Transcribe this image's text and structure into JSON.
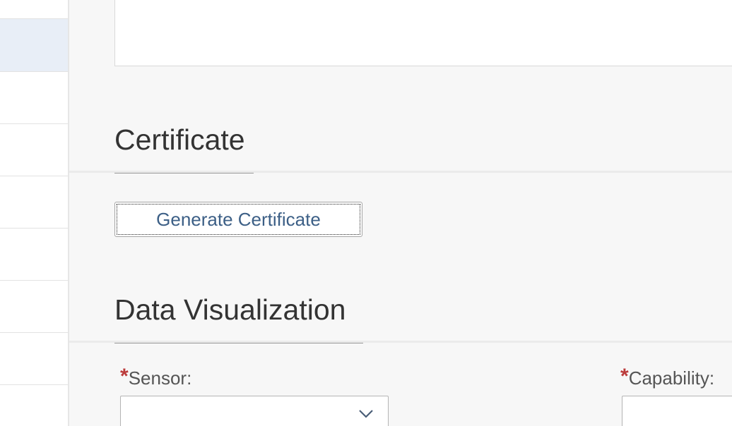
{
  "sections": {
    "certificate": {
      "title": "Certificate",
      "generate_button_label": "Generate Certificate"
    },
    "data_visualization": {
      "title": "Data Visualization",
      "fields": {
        "sensor": {
          "required_marker": "*",
          "label": "Sensor:",
          "value": ""
        },
        "capability": {
          "required_marker": "*",
          "label": "Capability:",
          "value": ""
        }
      }
    }
  },
  "icons": {
    "sensor_dropdown": "chevron-down-icon"
  },
  "colors": {
    "required": "#bb3b3b",
    "link_button_text": "#3c5f86",
    "selected_row": "#e8eef7"
  }
}
